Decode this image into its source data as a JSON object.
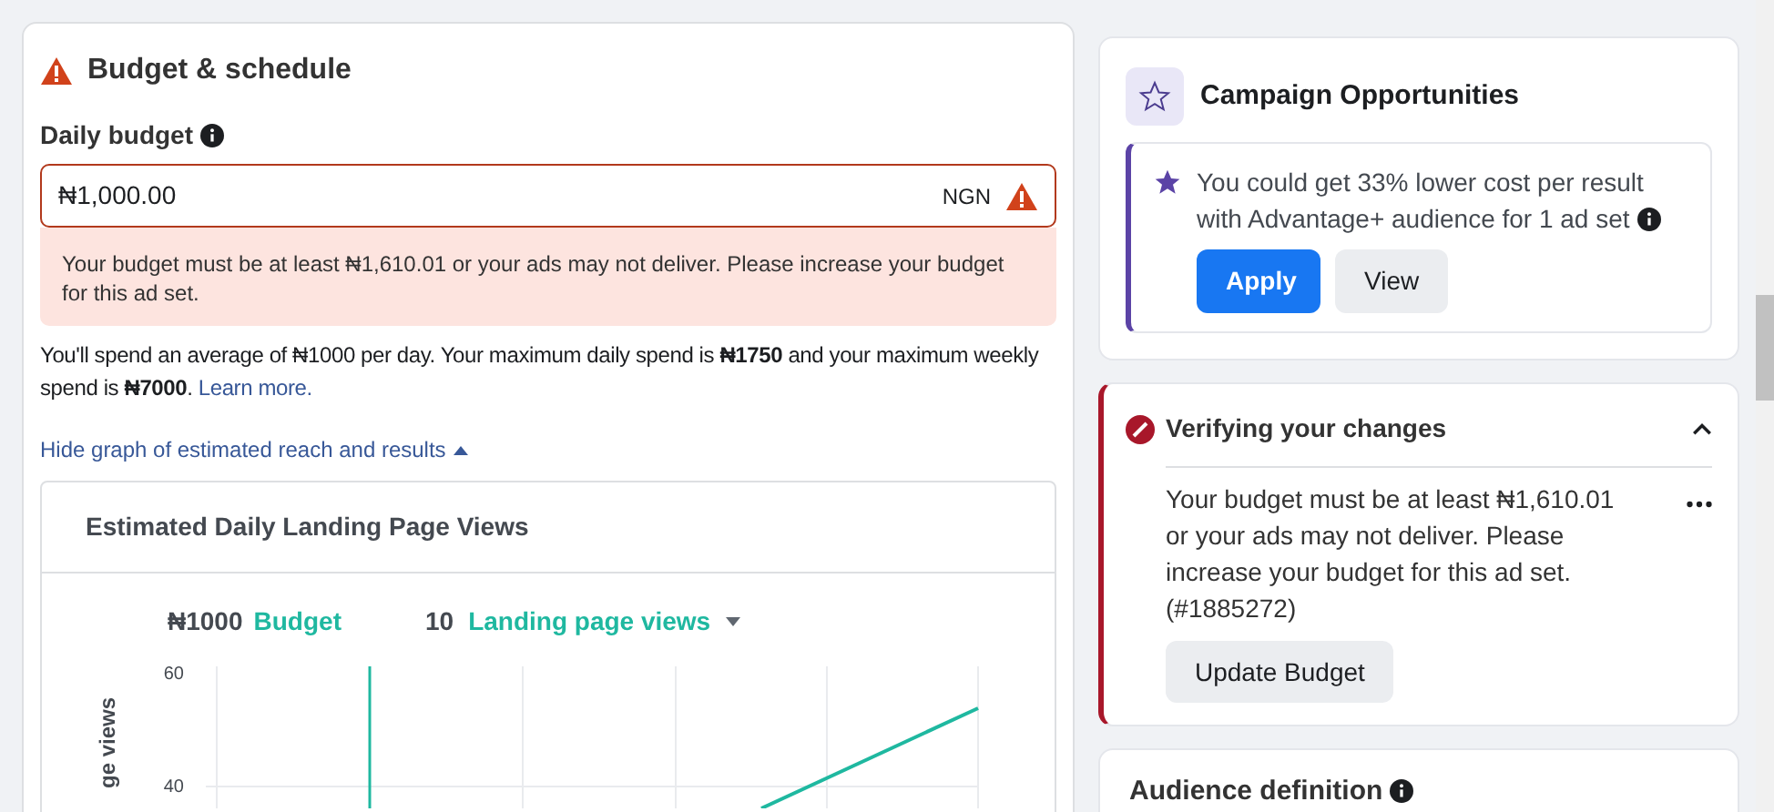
{
  "budget_section": {
    "title": "Budget & schedule",
    "field_label": "Daily budget",
    "field_value": "₦1,000.00",
    "currency": "NGN",
    "has_error": true,
    "error_message": "Your budget must be at least ₦1,610.01 or your ads may not deliver. Please increase your budget for this ad set.",
    "spend_note": "You'll spend an average of ₦1000 per day. Your maximum daily spend is **₦1750** and your maximum weekly spend is **₦7000**.",
    "learn_more_link": "Learn more.",
    "graph_toggle": "Hide graph of estimated reach and results",
    "graph_expanded": true
  },
  "estimate_chart": {
    "title": "Estimated Daily Landing Page Views",
    "budget_value": "₦1000",
    "budget_label": "Budget",
    "result_value": "10",
    "result_label": "Landing page views",
    "y_axis_label": "ge views",
    "y_ticks": [
      "60",
      "40"
    ]
  },
  "opportunities": {
    "title": "Campaign Opportunities",
    "message": "You could get 33% lower cost per result with Advantage+ audience for 1 ad set",
    "buttons": [
      {
        "label": "Apply",
        "kind": "primary"
      },
      {
        "label": "View",
        "kind": "secondary"
      }
    ]
  },
  "verification": {
    "title": "Verifying your changes",
    "expanded": true,
    "message": "Your budget must be at least ₦1,610.01 or your ads may not deliver. Please increase your budget for this ad set.",
    "code": "(#1885272)",
    "button": "Update Budget"
  },
  "audience": {
    "title": "Audience definition"
  }
}
